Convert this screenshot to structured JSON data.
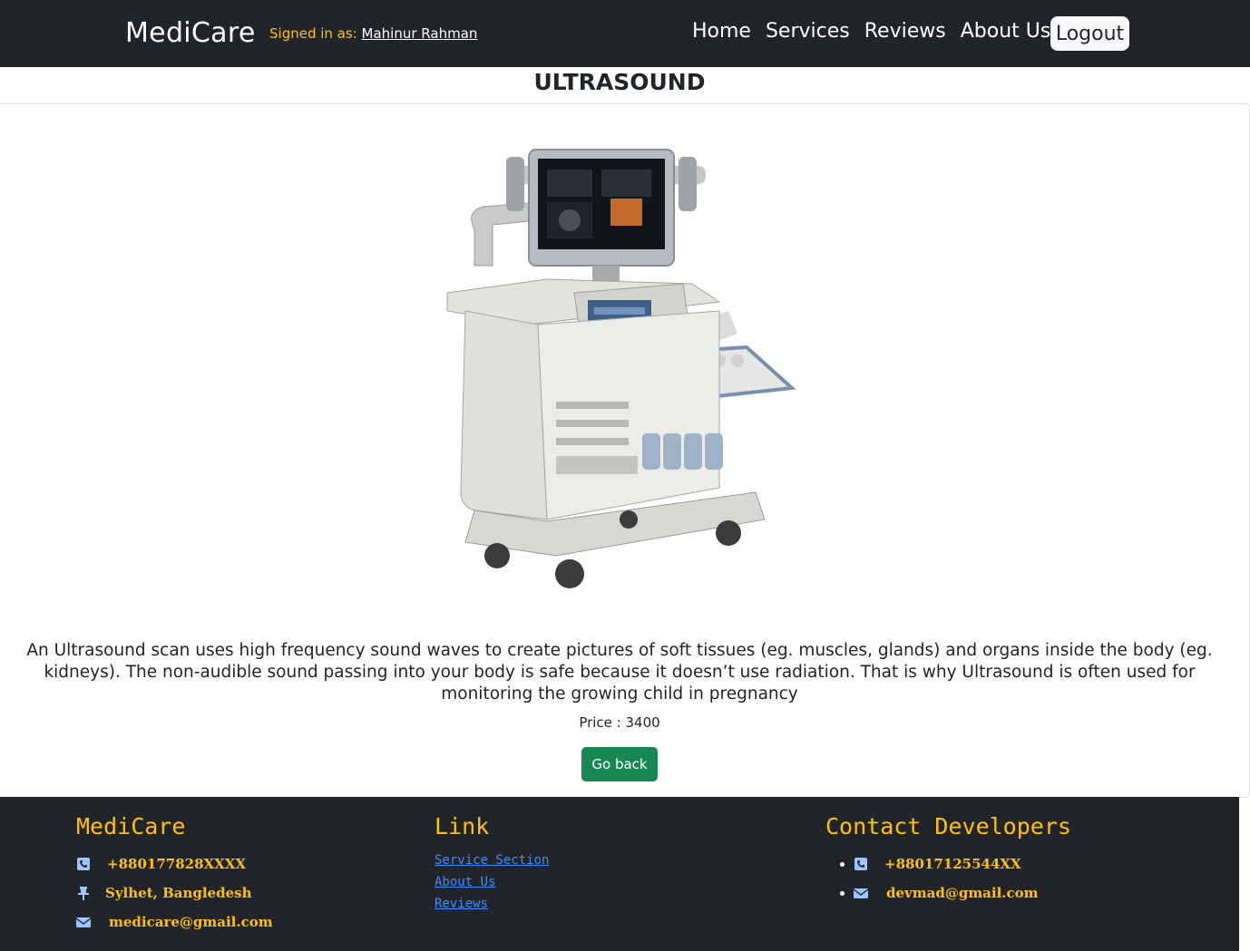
{
  "nav": {
    "brand": "MediCare",
    "signed_prefix": "Signed in as:",
    "user_name": "Mahinur Rahman",
    "links": [
      "Home",
      "Services",
      "Reviews",
      "About Us"
    ],
    "logout_label": "Logout"
  },
  "service": {
    "title": "ULTRASOUND",
    "description": "An Ultrasound scan uses high frequency sound waves to create pictures of soft tissues (eg. muscles, glands) and organs inside the body (eg. kidneys). The non-audible sound passing into your body is safe because it doesn’t use radiation. That is why Ultrasound is often used for monitoring the growing child in pregnancy",
    "price": "Price : 3400",
    "go_back_label": "Go back"
  },
  "footer": {
    "brand": "MediCare",
    "phone": "+880177828XXXX",
    "address": "Sylhet, Bangledesh",
    "email": "medicare@gmail.com",
    "link_title": "Link",
    "links": [
      "Service Section",
      "About Us",
      "Reviews"
    ],
    "contact_title": "Contact Developers",
    "dev_phone": "+88017125544XX",
    "dev_email": "devmad@gmail.com"
  },
  "colors": {
    "navbar": "#212529",
    "accent": "#ffc107",
    "button_green": "#198754",
    "link_blue": "#3d8bfd"
  },
  "icons": [
    "phone-icon",
    "pin-icon",
    "envelope-icon",
    "ultrasound-machine-image"
  ]
}
